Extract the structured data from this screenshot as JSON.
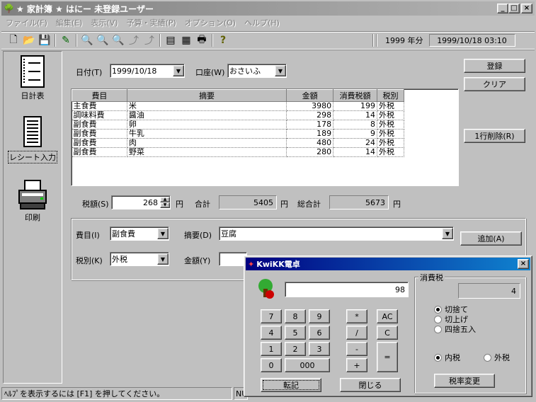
{
  "window": {
    "title": "★ 家計簿 ★ はにー 未登録ユーザー"
  },
  "menu": [
    "ファイル(F)",
    "編集(E)",
    "表示(V)",
    "予算・実績(P)",
    "オプション(O)",
    "ヘルプ(H)"
  ],
  "toolbar": {
    "year": "1999 年分",
    "datetime": "1999/10/18 03:10"
  },
  "nav": [
    {
      "label": "日計表",
      "icon": "daily-sheet-icon"
    },
    {
      "label": "レシート入力",
      "icon": "receipt-icon"
    },
    {
      "label": "印刷",
      "icon": "printer-icon"
    }
  ],
  "form": {
    "date_label": "日付(T)",
    "date_value": "1999/10/18",
    "account_label": "口座(W)",
    "account_value": "おさいふ",
    "register_button": "登録",
    "clear_button": "クリア",
    "delete_row_button": "1行削除(R)"
  },
  "grid": {
    "headers": [
      "費目",
      "摘要",
      "金額",
      "消費税額",
      "税別"
    ],
    "rows": [
      [
        "主食費",
        "米",
        "3980",
        "199",
        "外税"
      ],
      [
        "調味料費",
        "醤油",
        "298",
        "14",
        "外税"
      ],
      [
        "副食費",
        "卵",
        "178",
        "8",
        "外税"
      ],
      [
        "副食費",
        "牛乳",
        "189",
        "9",
        "外税"
      ],
      [
        "副食費",
        "肉",
        "480",
        "24",
        "外税"
      ],
      [
        "副食費",
        "野菜",
        "280",
        "14",
        "外税"
      ]
    ]
  },
  "totals": {
    "tax_label": "税額(S)",
    "tax_value": "268",
    "yen": "円",
    "sum_label": "合計",
    "sum_value": "5405",
    "grand_label": "総合計",
    "grand_value": "5673"
  },
  "entry": {
    "category_label": "費目(I)",
    "category_value": "副食費",
    "memo_label": "摘要(D)",
    "memo_value": "豆腐",
    "add_button": "追加(A)",
    "taxtype_label": "税別(K)",
    "taxtype_value": "外税",
    "amount_label": "金額(Y)"
  },
  "calculator": {
    "title": "KwiKK電卓",
    "display": "98",
    "keys": {
      "k7": "7",
      "k8": "8",
      "k9": "9",
      "k4": "4",
      "k5": "5",
      "k6": "6",
      "k1": "1",
      "k2": "2",
      "k3": "3",
      "k0": "0",
      "k000": "000",
      "mul": "*",
      "div": "/",
      "sub": "-",
      "add": "+",
      "ac": "AC",
      "c": "C",
      "eq": "="
    },
    "tax_group": "消費税",
    "tax_display": "4",
    "rounding": [
      "切捨て",
      "切上げ",
      "四捨五入"
    ],
    "taxmode": [
      "内税",
      "外税"
    ],
    "rate_button": "税率変更",
    "transfer_button": "転記",
    "close_button": "閉じる"
  },
  "status": {
    "help": "ﾍﾙﾌﾟを表示するには [F1] を押してください。",
    "nu": "NU"
  }
}
